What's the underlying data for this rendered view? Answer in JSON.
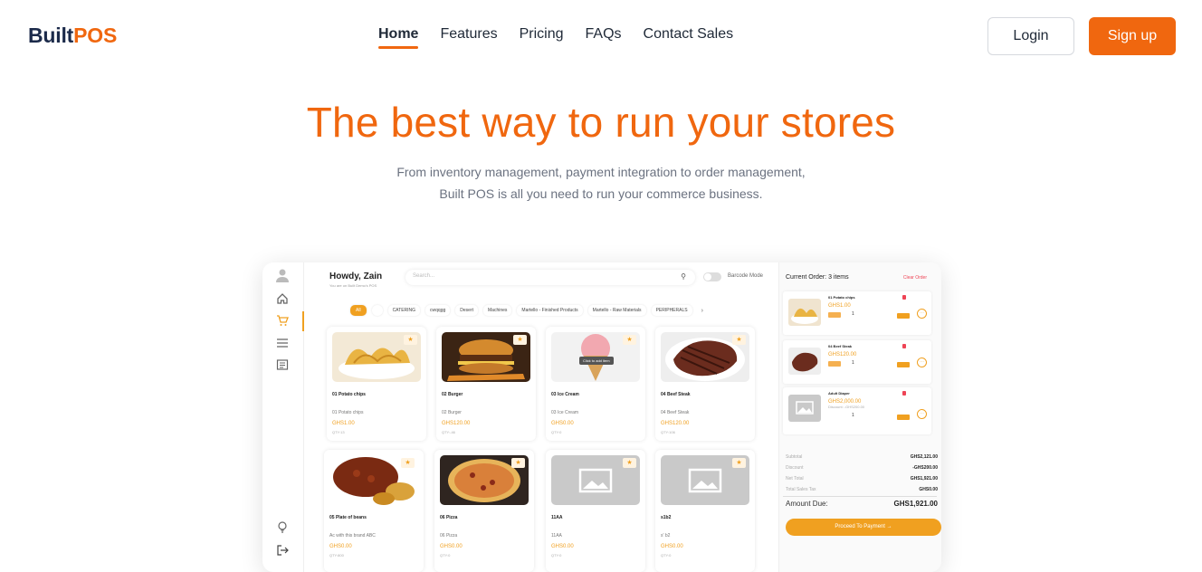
{
  "brand": {
    "part1": "Built",
    "part2": "POS"
  },
  "nav": {
    "items": [
      {
        "label": "Home",
        "active": true
      },
      {
        "label": "Features",
        "active": false
      },
      {
        "label": "Pricing",
        "active": false
      },
      {
        "label": "FAQs",
        "active": false
      },
      {
        "label": "Contact Sales",
        "active": false
      }
    ],
    "login_label": "Login",
    "signup_label": "Sign up"
  },
  "hero": {
    "title": "The best way to run your stores",
    "subtitle_line1": "From inventory management, payment integration to order management,",
    "subtitle_line2": "Built POS is all you need to run your commerce business."
  },
  "colors": {
    "accent": "#f0670f",
    "app_accent": "#f0a020",
    "brand_dark": "#1b2a4a"
  },
  "app": {
    "greeting": "Howdy, Zain",
    "greeting_sub": "You are on Built Demo's POS",
    "search_placeholder": "Search...",
    "barcode_label": "Barcode Mode",
    "categories": [
      "All",
      "CATERING",
      "cwqqgg",
      "Desert",
      "Machines",
      "Martello - Finished Products",
      "Martello - Raw Materials",
      "PERIPHERALS"
    ],
    "products": [
      {
        "name": "01 Potato chips",
        "desc": "01 Potato chips",
        "price": "GHS1.00",
        "qty": "QTY:13"
      },
      {
        "name": "02 Burger",
        "desc": "02 Burger",
        "price": "GHS120.00",
        "qty": "QTY:-46"
      },
      {
        "name": "03 Ice Cream",
        "desc": "03 Ice Cream",
        "price": "GHS0.00",
        "qty": "QTY:0",
        "tooltip": "Click to add item"
      },
      {
        "name": "04 Beef Steak",
        "desc": "04 Beef Steak",
        "price": "GHS120.00",
        "qty": "QTY:106"
      },
      {
        "name": "05 Plate of beans",
        "desc": "Ac with this brand ABC",
        "price": "GHS0.00",
        "qty": "QTY:800"
      },
      {
        "name": "06 Pizza",
        "desc": "06 Pizza",
        "price": "GHS0.00",
        "qty": "QTY:0"
      },
      {
        "name": "11AA",
        "desc": "11AA",
        "price": "GHS0.00",
        "qty": "QTY:0"
      },
      {
        "name": "s1b2",
        "desc": "s' b2",
        "price": "GHS0.00",
        "qty": "QTY:0"
      }
    ],
    "order": {
      "title": "Current Order: 3 items",
      "clear_label": "Clear Order",
      "items": [
        {
          "name": "01 Potato chips",
          "price": "GHS1.00",
          "qty": "1"
        },
        {
          "name": "04 Beef Steak",
          "price": "GHS120.00",
          "qty": "1"
        },
        {
          "name": "Adult Diaper",
          "price": "GHS2,000.00",
          "discount": "Discount: -GHS200.00",
          "qty": "1"
        }
      ],
      "summary": [
        {
          "label": "Subtotal",
          "value": "GHS2,121.00"
        },
        {
          "label": "Discount",
          "value": "-GHS200.00"
        },
        {
          "label": "Net Total",
          "value": "GHS1,921.00"
        },
        {
          "label": "Total Sales Tax",
          "value": "GHS0.00"
        }
      ],
      "amount_due_label": "Amount Due:",
      "amount_due_value": "GHS1,921.00",
      "pay_label": "Proceed To Payment →"
    }
  }
}
